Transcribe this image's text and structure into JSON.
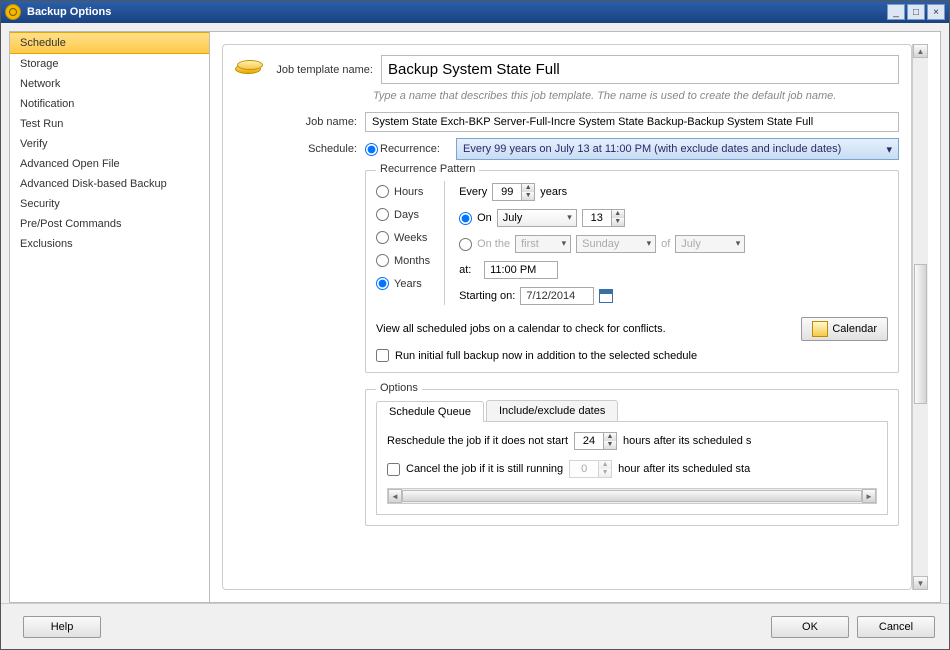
{
  "window": {
    "title": "Backup Options"
  },
  "sidebar": {
    "items": [
      "Schedule",
      "Storage",
      "Network",
      "Notification",
      "Test Run",
      "Verify",
      "Advanced Open File",
      "Advanced Disk-based Backup",
      "Security",
      "Pre/Post Commands",
      "Exclusions"
    ],
    "selected_index": 0
  },
  "template": {
    "label": "Job template name:",
    "value": "Backup System State Full",
    "hint": "Type a name that describes this job template. The name is used to create the default job name."
  },
  "job": {
    "label": "Job name:",
    "value": "System State Exch-BKP Server-Full-Incre System State Backup-Backup System State Full"
  },
  "schedule": {
    "label": "Schedule:",
    "recurrence_label": "Recurrence:",
    "recurrence_summary": "Every 99 years on July 13 at 11:00 PM (with exclude dates and include dates)",
    "pattern": {
      "legend": "Recurrence Pattern",
      "freq": {
        "options": [
          "Hours",
          "Days",
          "Weeks",
          "Months",
          "Years"
        ],
        "selected": "Years"
      },
      "every_label": "Every",
      "every_value": "99",
      "every_unit": "years",
      "on_label": "On",
      "month": "July",
      "day": "13",
      "onthe_label": "On the",
      "ordinal": "first",
      "weekday": "Sunday",
      "of_label": "of",
      "of_month": "July",
      "at_label": "at:",
      "at_value": "11:00 PM",
      "starting_label": "Starting on:",
      "starting_value": "7/12/2014"
    },
    "conflict_text": "View all scheduled jobs on a calendar to check for conflicts.",
    "calendar_btn": "Calendar",
    "run_initial": "Run initial full backup now in addition to the selected schedule"
  },
  "options": {
    "legend": "Options",
    "tabs": [
      "Schedule Queue",
      "Include/exclude dates"
    ],
    "active_tab": 0,
    "reschedule_pre": "Reschedule the job if it does not start",
    "reschedule_value": "24",
    "reschedule_post": "hours after its scheduled s",
    "cancel_label": "Cancel the job if it is still running",
    "cancel_value": "0",
    "cancel_post": "hour after its scheduled sta"
  },
  "footer": {
    "help": "Help",
    "ok": "OK",
    "cancel": "Cancel"
  }
}
